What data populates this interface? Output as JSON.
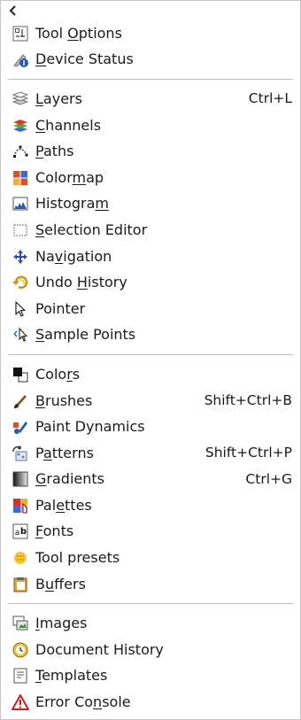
{
  "menu": {
    "back_icon": "chevron-left-icon",
    "groups": [
      [
        {
          "name": "tool-options",
          "icon": "tool-options-icon",
          "pre": "Tool ",
          "mn": "O",
          "post": "ptions",
          "shortcut": ""
        },
        {
          "name": "device-status",
          "icon": "device-status-icon",
          "pre": "",
          "mn": "D",
          "post": "evice Status",
          "shortcut": ""
        }
      ],
      [
        {
          "name": "layers",
          "icon": "layers-icon",
          "pre": "",
          "mn": "L",
          "post": "ayers",
          "shortcut": "Ctrl+L"
        },
        {
          "name": "channels",
          "icon": "channels-icon",
          "pre": "",
          "mn": "C",
          "post": "hannels",
          "shortcut": ""
        },
        {
          "name": "paths",
          "icon": "paths-icon",
          "pre": "",
          "mn": "P",
          "post": "aths",
          "shortcut": ""
        },
        {
          "name": "colormap",
          "icon": "colormap-icon",
          "pre": "Color",
          "mn": "m",
          "post": "ap",
          "shortcut": ""
        },
        {
          "name": "histogram",
          "icon": "histogram-icon",
          "pre": "Histogra",
          "mn": "m",
          "post": "",
          "shortcut": ""
        },
        {
          "name": "selection-editor",
          "icon": "selection-editor-icon",
          "pre": "",
          "mn": "S",
          "post": "election Editor",
          "shortcut": ""
        },
        {
          "name": "navigation",
          "icon": "navigation-icon",
          "pre": "Na",
          "mn": "v",
          "post": "igation",
          "shortcut": ""
        },
        {
          "name": "undo-history",
          "icon": "undo-history-icon",
          "pre": "Undo ",
          "mn": "H",
          "post": "istory",
          "shortcut": ""
        },
        {
          "name": "pointer",
          "icon": "pointer-icon",
          "pre": "Pointer",
          "mn": "",
          "post": "",
          "shortcut": ""
        },
        {
          "name": "sample-points",
          "icon": "sample-points-icon",
          "pre": "",
          "mn": "S",
          "post": "ample Points",
          "shortcut": ""
        }
      ],
      [
        {
          "name": "colors",
          "icon": "colors-icon",
          "pre": "Colo",
          "mn": "r",
          "post": "s",
          "shortcut": ""
        },
        {
          "name": "brushes",
          "icon": "brushes-icon",
          "pre": "",
          "mn": "B",
          "post": "rushes",
          "shortcut": "Shift+Ctrl+B"
        },
        {
          "name": "paint-dynamics",
          "icon": "paint-dynamics-icon",
          "pre": "Paint Dynamics",
          "mn": "",
          "post": "",
          "shortcut": ""
        },
        {
          "name": "patterns",
          "icon": "patterns-icon",
          "pre": "P",
          "mn": "a",
          "post": "tterns",
          "shortcut": "Shift+Ctrl+P"
        },
        {
          "name": "gradients",
          "icon": "gradients-icon",
          "pre": "",
          "mn": "G",
          "post": "radients",
          "shortcut": "Ctrl+G"
        },
        {
          "name": "palettes",
          "icon": "palettes-icon",
          "pre": "Pal",
          "mn": "e",
          "post": "ttes",
          "shortcut": ""
        },
        {
          "name": "fonts",
          "icon": "fonts-icon",
          "pre": "",
          "mn": "F",
          "post": "onts",
          "shortcut": ""
        },
        {
          "name": "tool-presets",
          "icon": "tool-presets-icon",
          "pre": "Tool presets",
          "mn": "",
          "post": "",
          "shortcut": ""
        },
        {
          "name": "buffers",
          "icon": "buffers-icon",
          "pre": "B",
          "mn": "u",
          "post": "ffers",
          "shortcut": ""
        }
      ],
      [
        {
          "name": "images",
          "icon": "images-icon",
          "pre": "",
          "mn": "I",
          "post": "mages",
          "shortcut": ""
        },
        {
          "name": "document-history",
          "icon": "document-history-icon",
          "pre": "Document History",
          "mn": "",
          "post": "",
          "shortcut": ""
        },
        {
          "name": "templates",
          "icon": "templates-icon",
          "pre": "",
          "mn": "T",
          "post": "emplates",
          "shortcut": ""
        },
        {
          "name": "error-console",
          "icon": "error-console-icon",
          "pre": "Error Co",
          "mn": "n",
          "post": "sole",
          "shortcut": ""
        }
      ]
    ]
  }
}
